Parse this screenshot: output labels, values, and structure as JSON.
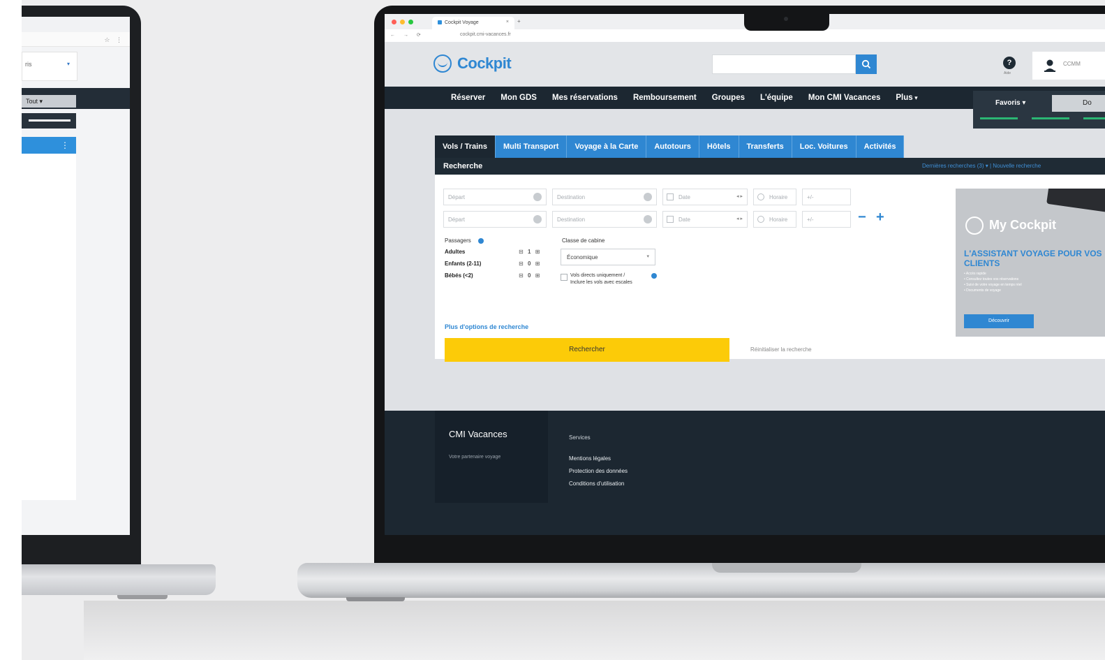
{
  "left_laptop": {
    "dropdown_value": "ris",
    "filter_label": "Tout ▾"
  },
  "browser": {
    "tab_title": "Cockpit Voyage",
    "url": "cockpit.cmi-vacances.fr"
  },
  "header": {
    "logo_text": "Cockpit",
    "search_placeholder": "",
    "help_caption": "Aide",
    "user_name": "CCMM"
  },
  "nav": {
    "items": [
      "Réserver",
      "Mon GDS",
      "Mes réservations",
      "Remboursement",
      "Groupes",
      "L'équipe",
      "Mon CMI Vacances",
      "Plus"
    ],
    "favorites_label": "Favoris ▾",
    "favorites_button": "Do"
  },
  "search": {
    "tabs": [
      "Vols / Trains",
      "Multi Transport",
      "Voyage à la Carte",
      "Autotours",
      "Hôtels",
      "Transferts",
      "Loc. Voitures",
      "Activités"
    ],
    "panel_title": "Recherche",
    "panel_links": "Dernières recherches (3) ▾  |  Nouvelle recherche",
    "origin_placeholder": "Départ",
    "destination_placeholder": "Destination",
    "date_placeholder": "Date",
    "time_placeholder": "Horaire",
    "flex_placeholder": "+/-",
    "passengers_label": "Passagers",
    "passengers": [
      {
        "label": "Adultes",
        "value": "1"
      },
      {
        "label": "Enfants (2-11)",
        "value": "0"
      },
      {
        "label": "Bébés (<2)",
        "value": "0"
      }
    ],
    "cabin_label": "Classe de cabine",
    "cabin_value": "Économique",
    "direct_checkbox_text": "Vols directs uniquement / Inclure les vols avec escales",
    "more_options": "Plus d'options de recherche",
    "submit_label": "Rechercher",
    "reset_label": "Réinitialiser la recherche"
  },
  "promo": {
    "title": "My Cockpit",
    "headline": "L'ASSISTANT VOYAGE POUR VOS CLIENTS",
    "bullets": [
      "• Accès rapide",
      "• Consultez toutes vos réservations",
      "• Suivi de votre voyage en temps réel",
      "• Documents de voyage"
    ],
    "button": "Découvrir"
  },
  "footer": {
    "brand": "CMI Vacances",
    "tagline": "Votre partenaire voyage",
    "column_title": "Services",
    "links": [
      "Mentions légales",
      "Protection des données",
      "Conditions d'utilisation"
    ]
  },
  "colors": {
    "brand_blue": "#2f87d2",
    "nav_dark": "#1c2731",
    "cta_yellow": "#fccb08"
  }
}
